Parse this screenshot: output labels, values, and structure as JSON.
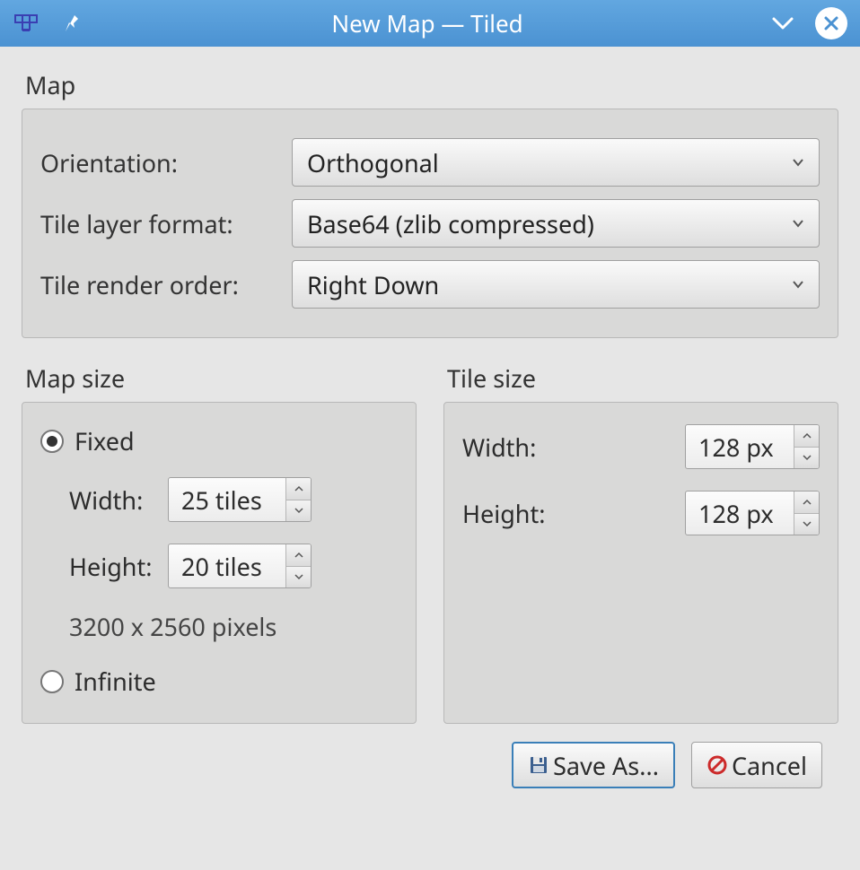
{
  "window": {
    "title": "New Map — Tiled"
  },
  "sections": {
    "map": {
      "label": "Map",
      "orientation_label": "Orientation:",
      "orientation_value": "Orthogonal",
      "tile_layer_format_label": "Tile layer format:",
      "tile_layer_format_value": "Base64 (zlib compressed)",
      "tile_render_order_label": "Tile render order:",
      "tile_render_order_value": "Right Down"
    },
    "map_size": {
      "label": "Map size",
      "fixed_label": "Fixed",
      "fixed_checked": true,
      "infinite_label": "Infinite",
      "infinite_checked": false,
      "width_label": "Width:",
      "width_value": "25 tiles",
      "height_label": "Height:",
      "height_value": "20 tiles",
      "pixels_info": "3200 x 2560 pixels"
    },
    "tile_size": {
      "label": "Tile size",
      "width_label": "Width:",
      "width_value": "128 px",
      "height_label": "Height:",
      "height_value": "128 px"
    }
  },
  "footer": {
    "save_as_label": "Save As...",
    "cancel_label": "Cancel"
  }
}
